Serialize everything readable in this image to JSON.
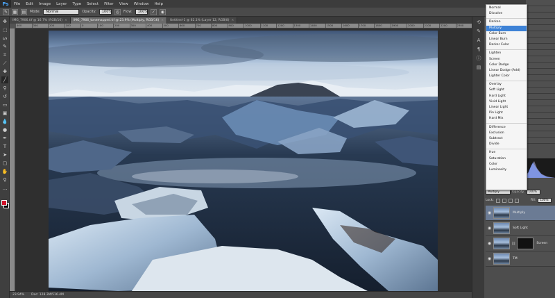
{
  "app": {
    "logo": "Ps"
  },
  "menubar": [
    "File",
    "Edit",
    "Image",
    "Layer",
    "Type",
    "Select",
    "Filter",
    "View",
    "Window",
    "Help"
  ],
  "options": {
    "mode_label": "Mode:",
    "mode_value": "Normal",
    "opacity_label": "Opacity:",
    "opacity_value": "100%",
    "flow_label": "Flow:",
    "flow_value": "100%"
  },
  "tabs": [
    {
      "label": "IMG_7906.tif @ 16.7% (RGB/16)"
    },
    {
      "label": "IMG_7906_tonemapped.tif @ 23.9% (Multiply, RGB/16)"
    },
    {
      "label": "Untitled-1 @ 62.1% (Layer 12, RGB/8)"
    }
  ],
  "ruler_ticks": [
    "400",
    "300",
    "200",
    "100",
    "0",
    "100",
    "200",
    "300",
    "400",
    "500",
    "600",
    "700",
    "800",
    "900",
    "1000",
    "1100",
    "1200",
    "1300",
    "1400",
    "1500",
    "1600",
    "1700",
    "1800",
    "1900",
    "2000",
    "2100",
    "2200",
    "2300"
  ],
  "status": {
    "zoom": "23.94%",
    "doc": "Doc: 128.3M/516.4M"
  },
  "blend_modes": [
    [
      "Normal",
      "Dissolve"
    ],
    [
      "Darken",
      "Multiply",
      "Color Burn",
      "Linear Burn",
      "Darker Color"
    ],
    [
      "Lighten",
      "Screen",
      "Color Dodge",
      "Linear Dodge (Add)",
      "Lighter Color"
    ],
    [
      "Overlay",
      "Soft Light",
      "Hard Light",
      "Vivid Light",
      "Linear Light",
      "Pin Light",
      "Hard Mix"
    ],
    [
      "Difference",
      "Exclusion",
      "Subtract",
      "Divide"
    ],
    [
      "Hue",
      "Saturation",
      "Color",
      "Luminosity"
    ]
  ],
  "selected_blend": "Multiply",
  "layer_controls": {
    "blend_value": "Multiply",
    "opacity_label": "Opacity:",
    "opacity_value": "100%",
    "lock_label": "Lock:",
    "fill_label": "Fill:",
    "fill_value": "100%"
  },
  "layers": [
    {
      "name": "Multiply",
      "active": true,
      "mask": false
    },
    {
      "name": "Soft Light",
      "active": false,
      "mask": false
    },
    {
      "name": "Screen",
      "active": false,
      "mask": true
    },
    {
      "name": "TM",
      "active": false,
      "mask": false
    }
  ],
  "colors": {
    "foreground": "#d2142b",
    "background": "#000000",
    "selection": "#3d82d6"
  }
}
